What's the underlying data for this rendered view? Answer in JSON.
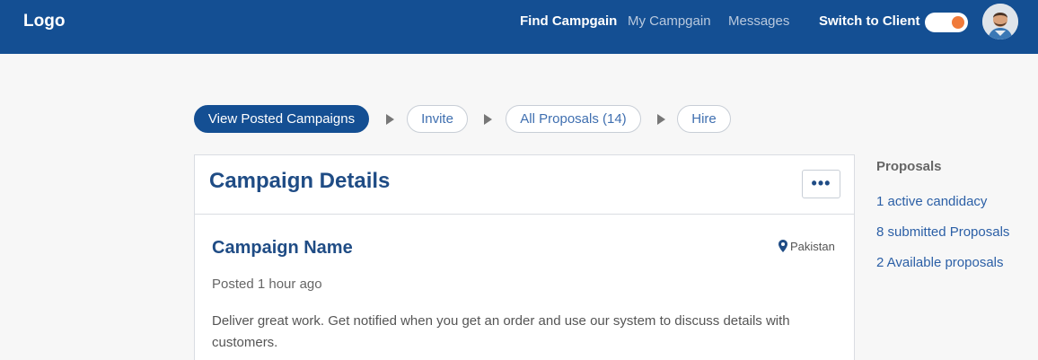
{
  "header": {
    "logo": "Logo",
    "nav": [
      "Find Campgain",
      "My Campgain",
      "Messages"
    ],
    "switch_label": "Switch to Client",
    "toggle_on": true,
    "avatar_icon": "user-avatar"
  },
  "steps": [
    "View Posted Campaigns",
    "Invite",
    "All Proposals (14)",
    "Hire"
  ],
  "card": {
    "title": "Campaign Details",
    "menu_label": "•••",
    "campaign_name": "Campaign Name",
    "location": "Pakistan",
    "posted": "Posted 1 hour ago",
    "description": "Deliver great work. Get notified when you get an order and use our system to discuss details with customers."
  },
  "sidebar": {
    "title": "Proposals",
    "links": [
      "1 active candidacy",
      "8 submitted Proposals",
      "2 Available proposals"
    ]
  },
  "colors": {
    "primary": "#144f93",
    "accent": "#f07a3a",
    "link": "#2b5fa6"
  }
}
